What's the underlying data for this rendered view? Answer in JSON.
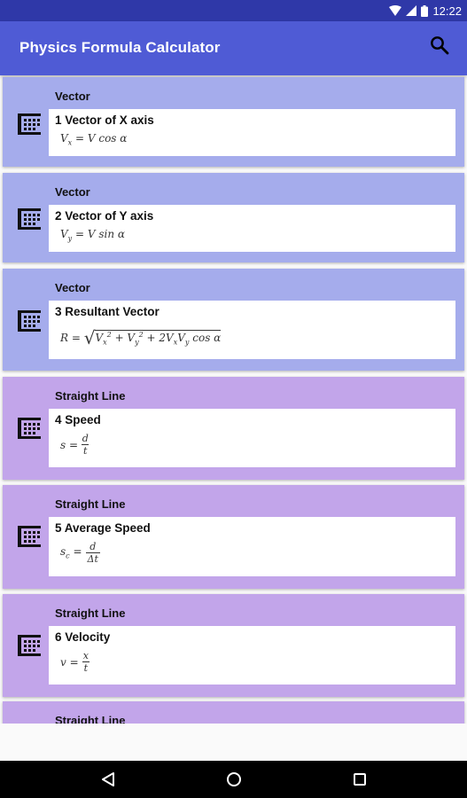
{
  "status_bar": {
    "time": "12:22"
  },
  "app_bar": {
    "title": "Physics Formula Calculator"
  },
  "cards": [
    {
      "category": "Vector",
      "title": "1 Vector of X axis"
    },
    {
      "category": "Vector",
      "title": "2 Vector of Y axis"
    },
    {
      "category": "Vector",
      "title": "3 Resultant Vector"
    },
    {
      "category": "Straight Line",
      "title": "4 Speed"
    },
    {
      "category": "Straight Line",
      "title": "5 Average Speed"
    },
    {
      "category": "Straight Line",
      "title": "6 Velocity"
    },
    {
      "category": "Straight Line"
    }
  ],
  "icons": {
    "search": "search-icon",
    "card": "calculator-icon",
    "back": "back-triangle-icon",
    "home": "home-circle-icon",
    "recents": "recents-square-icon"
  },
  "colors": {
    "status_bar": "#2f38a8",
    "app_bar": "#4f5bd5",
    "vector_card": "#a5acec",
    "straight_line_card": "#c2a5ea"
  }
}
